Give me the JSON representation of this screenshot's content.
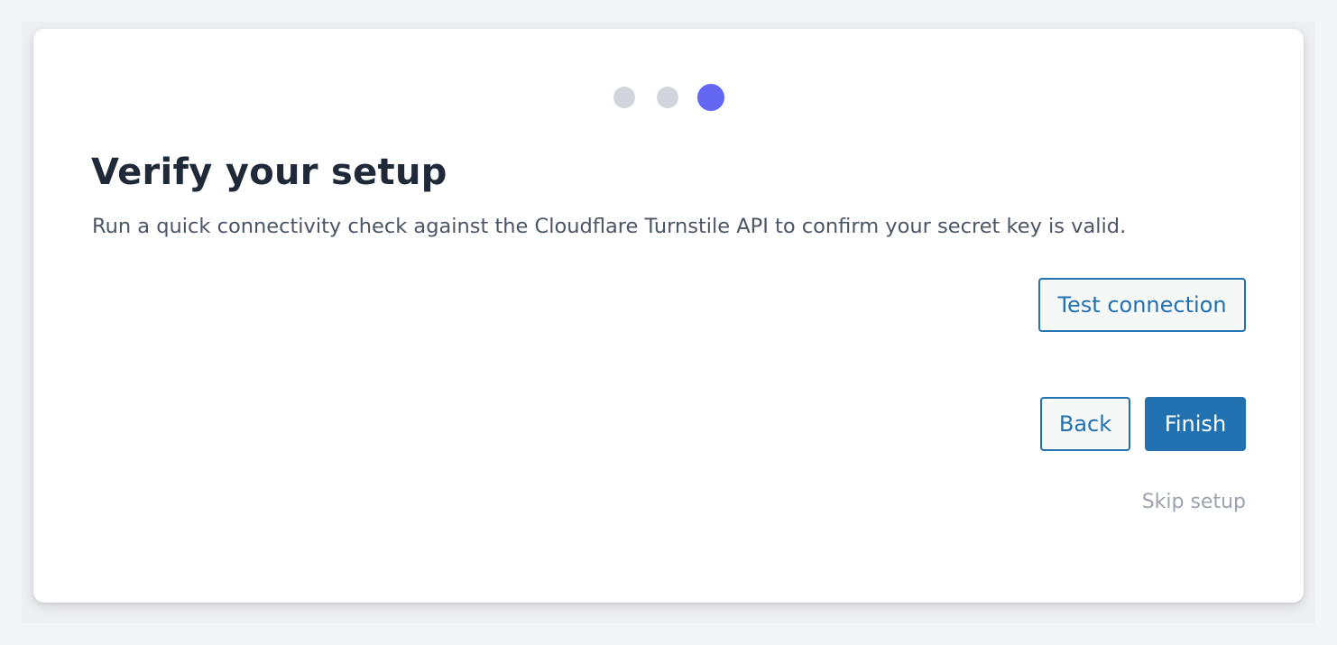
{
  "wizard": {
    "steps": [
      {
        "state": "inactive"
      },
      {
        "state": "inactive"
      },
      {
        "state": "active"
      }
    ],
    "current_step": 3,
    "total_steps": 3,
    "title": "Verify your setup",
    "description": "Run a quick connectivity check against the Cloudflare Turnstile API to confirm your secret key is valid.",
    "test_button_label": "Test connection",
    "back_button_label": "Back",
    "finish_button_label": "Finish",
    "skip_link_label": "Skip setup"
  },
  "colors": {
    "accent": "#6366f1",
    "primary": "#2271b1",
    "inactive_dot": "#d2d6dc",
    "title": "#1f2937",
    "muted": "#9ca3af"
  }
}
